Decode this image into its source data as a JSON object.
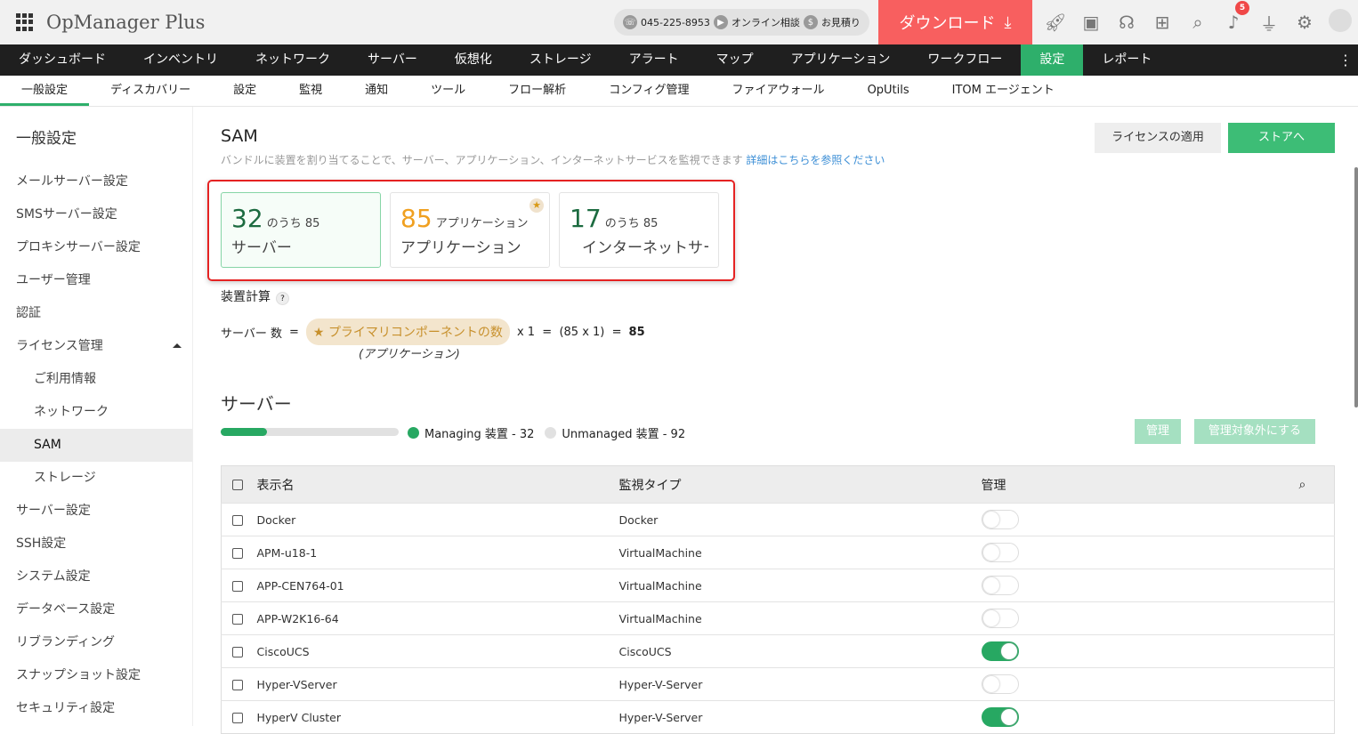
{
  "app": {
    "title": "OpManager Plus",
    "phone": "045-225-8953",
    "consult": "オンライン相談",
    "quote": "お見積り",
    "download": "ダウンロード",
    "notifications": "5"
  },
  "mainnav": [
    "ダッシュボード",
    "インベントリ",
    "ネットワーク",
    "サーバー",
    "仮想化",
    "ストレージ",
    "アラート",
    "マップ",
    "アプリケーション",
    "ワークフロー",
    "設定",
    "レポート"
  ],
  "subnav": [
    "一般設定",
    "ディスカバリー",
    "設定",
    "監視",
    "通知",
    "ツール",
    "フロー解析",
    "コンフィグ管理",
    "ファイアウォール",
    "OpUtils",
    "ITOM エージェント"
  ],
  "sidebar": {
    "title": "一般設定",
    "items": [
      "メールサーバー設定",
      "SMSサーバー設定",
      "プロキシサーバー設定",
      "ユーザー管理",
      "認証",
      "ライセンス管理",
      "ご利用情報",
      "ネットワーク",
      "SAM",
      "ストレージ",
      "サーバー設定",
      "SSH設定",
      "システム設定",
      "データベース設定",
      "リブランディング",
      "スナップショット設定",
      "セキュリティ設定"
    ]
  },
  "page": {
    "title": "SAM",
    "description": "バンドルに装置を割り当てることで、サーバー、アプリケーション、インターネットサービスを監視できます",
    "link": "詳細はこちらを参照ください",
    "apply_license": "ライセンスの適用",
    "store": "ストアへ"
  },
  "cards": [
    {
      "num": "32",
      "of": "のうち 85",
      "label": "サーバー"
    },
    {
      "num": "85",
      "of": "アプリケーション",
      "label": "アプリケーション"
    },
    {
      "num": "17",
      "of": "のうち 85",
      "label": "インターネットサービス"
    }
  ],
  "calc": {
    "title": "装置計算",
    "help": "?",
    "lhs": "サーバー 数",
    "eq": "=",
    "pill": "プライマリコンポーネントの数",
    "pill_sub": "(アプリケーション)",
    "rhs": "x 1  =  (85 x 1)  =",
    "result": "85"
  },
  "servers": {
    "title": "サーバー",
    "managed_fraction": 0.26,
    "managing": "Managing 装置 - 32",
    "unmanaged": "Unmanaged 装置 - 92",
    "manage_btn": "管理",
    "unmanage_btn": "管理対象外にする",
    "columns": [
      "表示名",
      "監視タイプ",
      "管理"
    ],
    "rows": [
      {
        "name": "Docker",
        "type": "Docker",
        "managed": false
      },
      {
        "name": "APM-u18-1",
        "type": "VirtualMachine",
        "managed": false
      },
      {
        "name": "APP-CEN764-01",
        "type": "VirtualMachine",
        "managed": false
      },
      {
        "name": "APP-W2K16-64",
        "type": "VirtualMachine",
        "managed": false
      },
      {
        "name": "CiscoUCS",
        "type": "CiscoUCS",
        "managed": true
      },
      {
        "name": "Hyper-VServer",
        "type": "Hyper-V-Server",
        "managed": false
      },
      {
        "name": "HyperV Cluster",
        "type": "Hyper-V-Server",
        "managed": true
      }
    ]
  },
  "colors": {
    "accent": "#2eaf6b",
    "download": "#f85f5f",
    "highlight": "#e52222"
  }
}
